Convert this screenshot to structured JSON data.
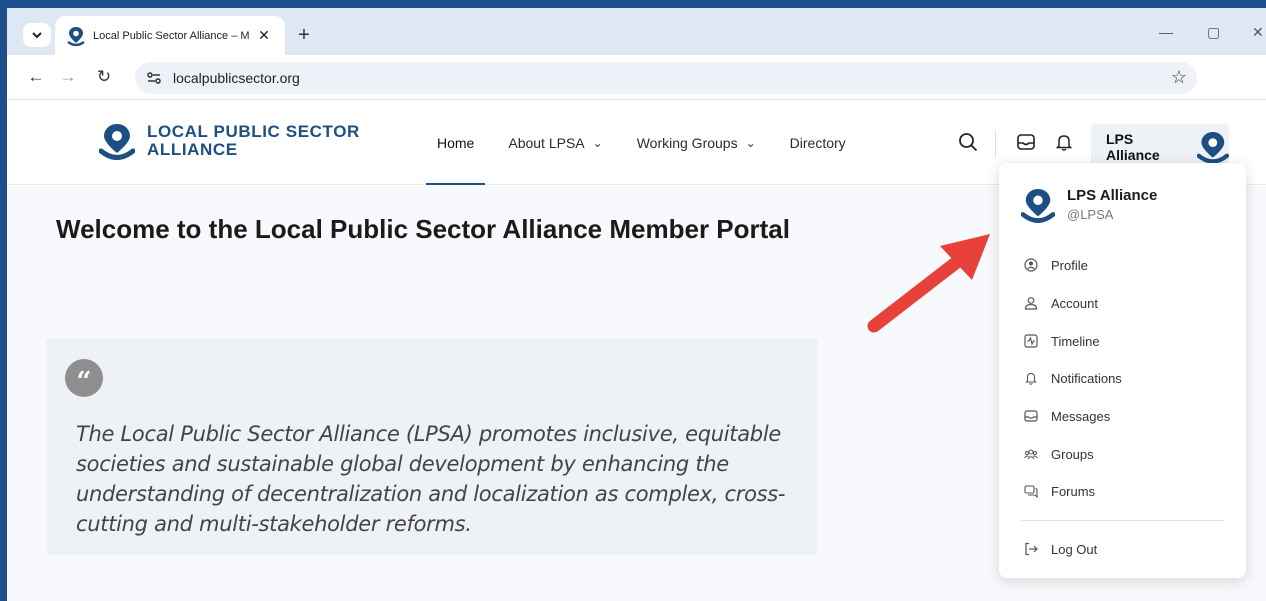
{
  "browser": {
    "tab_title": "Local Public Sector Alliance – M",
    "tab_close": "✕",
    "new_tab": "+",
    "url": "localpublicsector.org"
  },
  "site": {
    "logo_line1": "LOCAL PUBLIC SECTOR",
    "logo_line2": "ALLIANCE",
    "nav": [
      {
        "label": "Home"
      },
      {
        "label": "About LPSA"
      },
      {
        "label": "Working Groups"
      },
      {
        "label": "Directory"
      }
    ],
    "user_chip": "LPS Alliance",
    "brand_color": "#1d4f82"
  },
  "main": {
    "welcome": "Welcome to the Local Public Sector Alliance Member Portal",
    "quote": "The Local Public Sector Alliance (LPSA) promotes inclusive, equitable societies and sustainable global development by enhancing the understanding of decentralization and localization as complex, cross-cutting and multi-stakeholder reforms."
  },
  "dropdown": {
    "name": "LPS Alliance",
    "handle": "@LPSA",
    "items": [
      {
        "label": "Profile",
        "icon": "user-circle-icon"
      },
      {
        "label": "Account",
        "icon": "user-icon"
      },
      {
        "label": "Timeline",
        "icon": "activity-icon"
      },
      {
        "label": "Notifications",
        "icon": "bell-icon"
      },
      {
        "label": "Messages",
        "icon": "inbox-icon"
      },
      {
        "label": "Groups",
        "icon": "users-icon"
      },
      {
        "label": "Forums",
        "icon": "chat-icon"
      }
    ],
    "logout": "Log Out"
  },
  "annotation": {
    "arrow_color": "#e8403a"
  }
}
